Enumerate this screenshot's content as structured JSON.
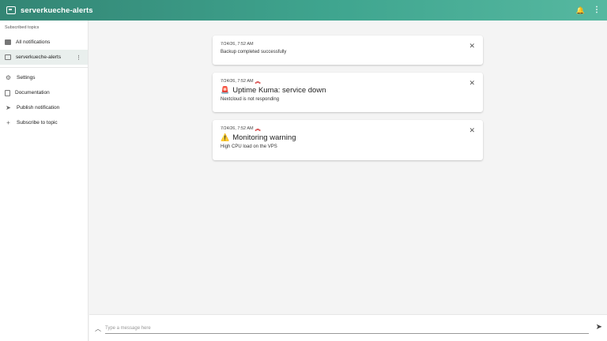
{
  "appbar": {
    "title": "serverkueche-alerts",
    "icons": {
      "logo": "message-icon",
      "bell": "bell-icon",
      "menu": "kebab-menu-icon"
    }
  },
  "sidebar": {
    "section_label": "Subscribed topics",
    "topics": [
      {
        "label": "All notifications",
        "icon": "chat-fill-icon"
      },
      {
        "label": "serverkueche-alerts",
        "icon": "chat-outline-icon",
        "selected": true
      }
    ],
    "links": [
      {
        "label": "Settings",
        "icon": "gear-icon"
      },
      {
        "label": "Documentation",
        "icon": "document-icon"
      },
      {
        "label": "Publish notification",
        "icon": "send-icon"
      },
      {
        "label": "Subscribe to topic",
        "icon": "plus-icon"
      }
    ]
  },
  "notifications": [
    {
      "timestamp": "7/24/26, 7:52 AM",
      "title": "",
      "message": "Backup completed successfully",
      "priority_icon": false
    },
    {
      "timestamp": "7/24/26, 7:52 AM",
      "emoji": "🚨",
      "title": "Uptime Kuma: service down",
      "message": "Nextcloud is not responding",
      "priority_icon": true
    },
    {
      "timestamp": "7/24/26, 7:52 AM",
      "emoji": "⚠️",
      "title": "Monitoring warning",
      "message": "High CPU load on the VPS",
      "priority_icon": true
    }
  ],
  "composer": {
    "placeholder": "Type a message here"
  },
  "colors": {
    "accent": "#3fa58f",
    "priority": "#d02a2a"
  }
}
